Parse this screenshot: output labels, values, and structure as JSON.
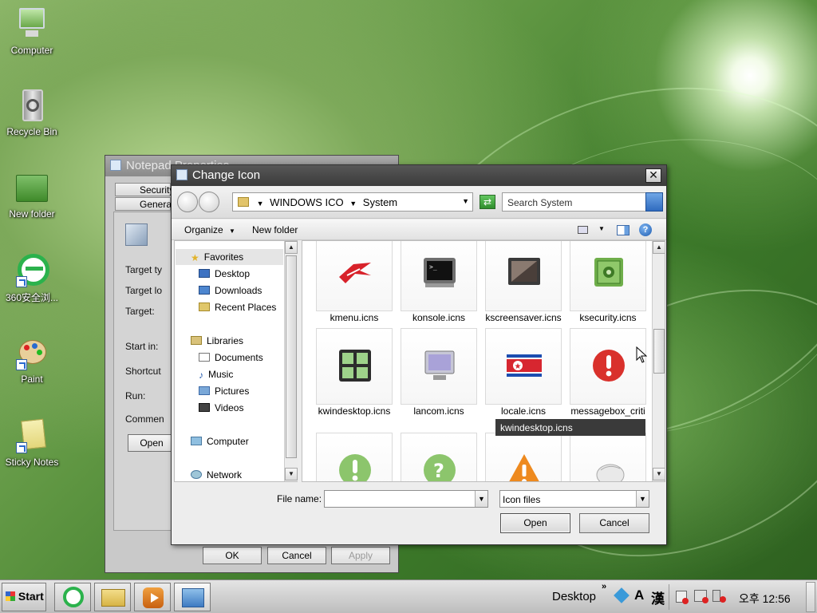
{
  "desktop": {
    "icons": [
      {
        "label": "Computer"
      },
      {
        "label": "Recycle Bin"
      },
      {
        "label": "New folder"
      },
      {
        "label": "360安全浏..."
      },
      {
        "label": "Paint"
      },
      {
        "label": "Sticky Notes"
      }
    ]
  },
  "props_window": {
    "title": "Notepad Properties",
    "tabs": [
      "Security",
      "General"
    ],
    "labels": [
      "Target ty",
      "Target lo",
      "Target:",
      "Start in:",
      "Shortcut",
      "Run:",
      "Commen"
    ],
    "open_button": "Open",
    "ok": "OK",
    "cancel": "Cancel",
    "apply": "Apply"
  },
  "dialog": {
    "title": "Change Icon",
    "breadcrumb": [
      "WINDOWS ICO",
      "System"
    ],
    "search_placeholder": "Search System",
    "toolbar": {
      "organize": "Organize",
      "new_folder": "New folder"
    },
    "nav": {
      "favorites": "Favorites",
      "desktop": "Desktop",
      "downloads": "Downloads",
      "recent": "Recent Places",
      "libraries": "Libraries",
      "documents": "Documents",
      "music": "Music",
      "pictures": "Pictures",
      "videos": "Videos",
      "computer": "Computer",
      "network": "Network"
    },
    "files": [
      {
        "name": "kmenu.icns",
        "icon": "kmenu-icon"
      },
      {
        "name": "konsole.icns",
        "icon": "konsole-icon"
      },
      {
        "name": "kscreensaver.icns",
        "icon": "kscreensaver-icon"
      },
      {
        "name": "ksecurity.icns",
        "icon": "safe-icon"
      },
      {
        "name": "kwindesktop.icns",
        "icon": "kwindesktop-icon"
      },
      {
        "name": "lancom.icns",
        "icon": "monitor-icon"
      },
      {
        "name": "locale.icns",
        "icon": "flag-icon"
      },
      {
        "name": "messagebox_criti",
        "icon": "critical-icon"
      }
    ],
    "tooltip": "kwindesktop.icns",
    "file_name_label": "File name:",
    "file_name_value": "",
    "file_type": "Icon files",
    "open": "Open",
    "cancel": "Cancel"
  },
  "taskbar": {
    "start": "Start",
    "desktop_label": "Desktop",
    "lang_a": "A",
    "lang_han": "漢",
    "clock": "오후 12:56"
  },
  "colors": {
    "dialog_title": "#3f3f3f",
    "tooltip_bg": "#3a3a3a",
    "selected_nav": "#e5e5e5"
  }
}
